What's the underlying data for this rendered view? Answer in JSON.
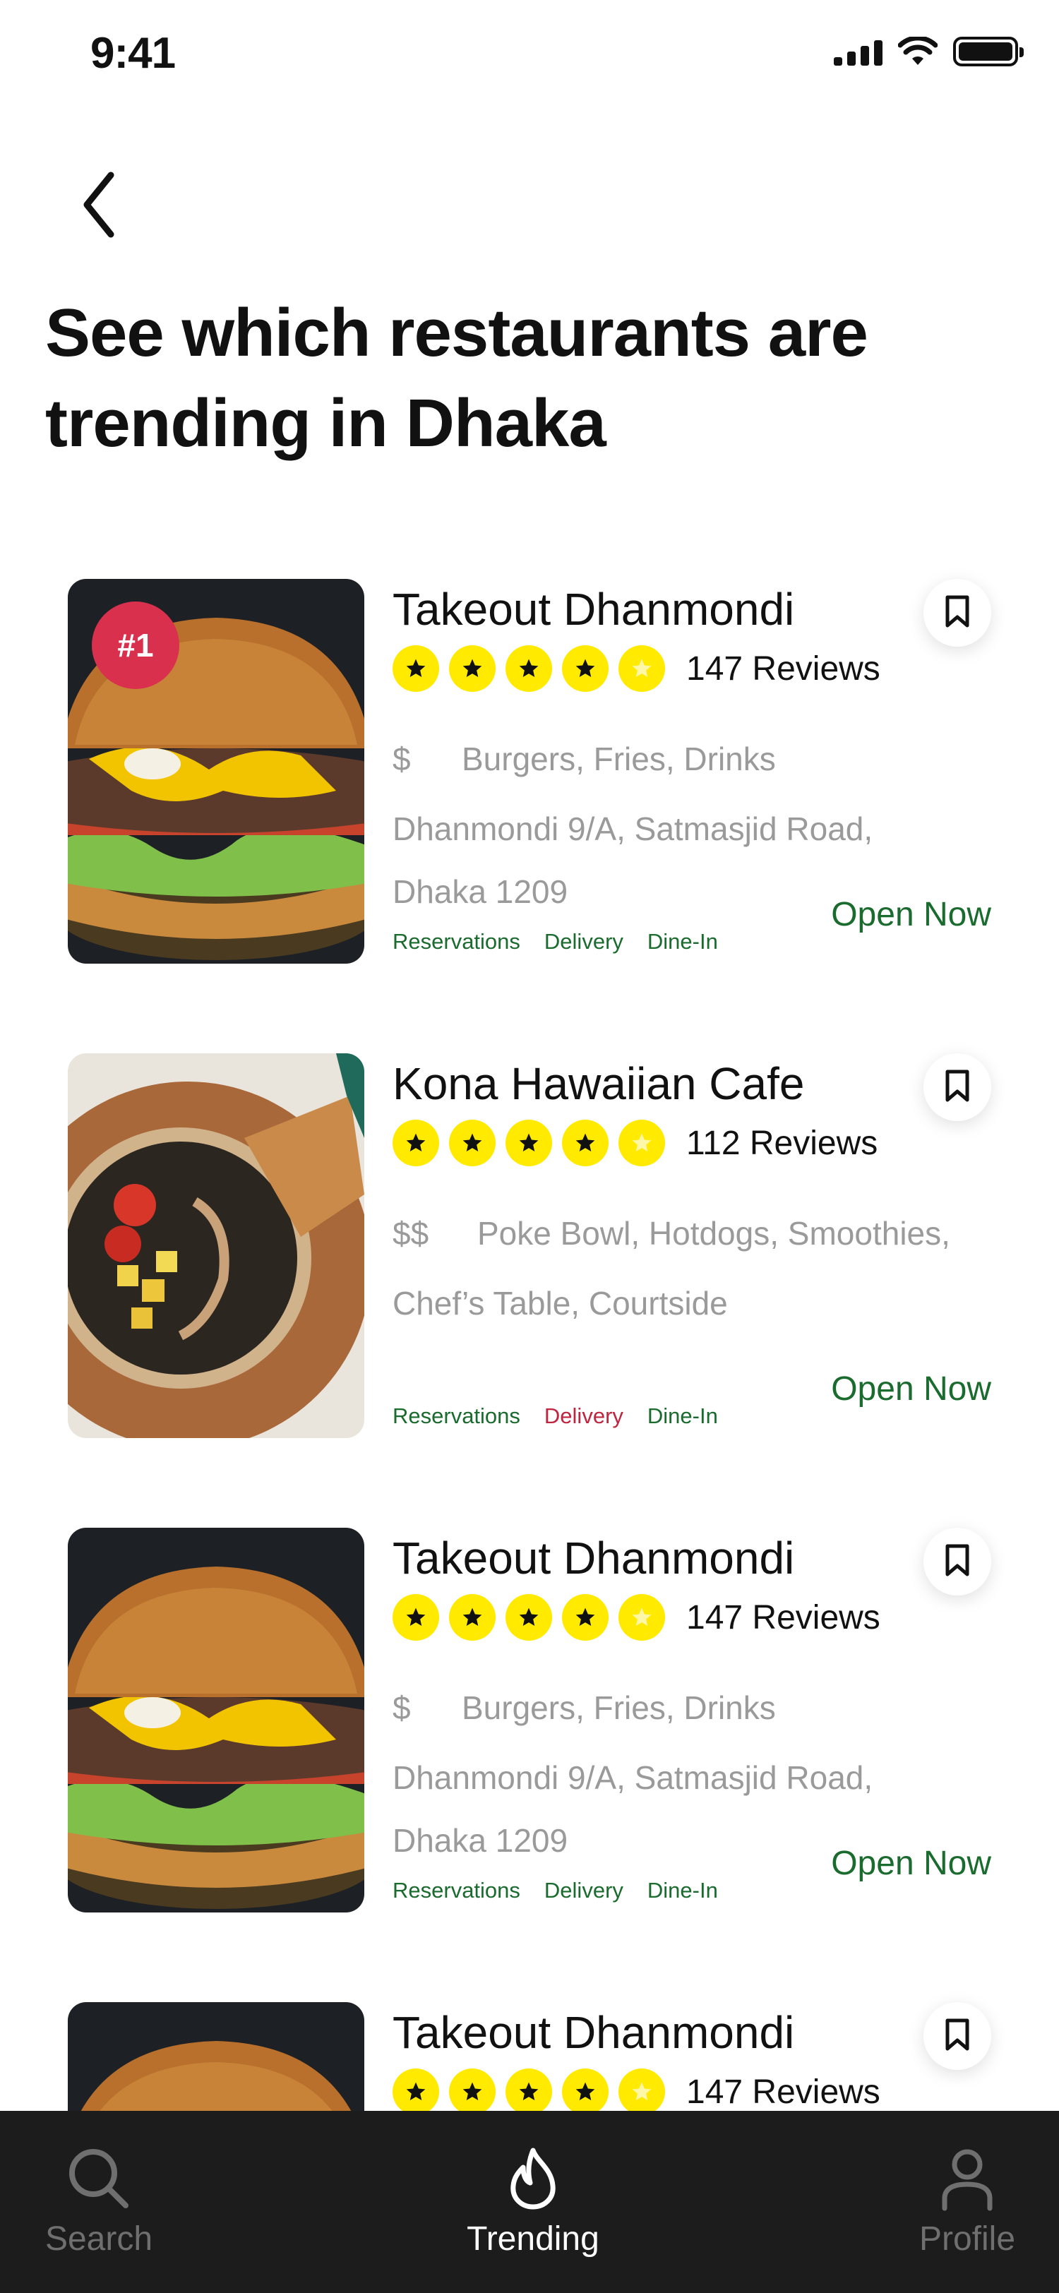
{
  "status_bar": {
    "time": "9:41"
  },
  "header": {
    "title": "See which restaurants are trending in Dhaka"
  },
  "colors": {
    "star": "#FFEA00",
    "badge": "#D9304E",
    "open": "#1A6B2E",
    "service_available": "#1A6B2E",
    "service_unavailable": "#C0253F",
    "nav_background": "#1C1C1C"
  },
  "restaurants": [
    {
      "rank": "#1",
      "name": "Takeout Dhanmondi",
      "rating": 5,
      "reviews": "147 Reviews",
      "price": "$",
      "cuisine": "Burgers, Fries, Drinks",
      "address_line1": "Dhanmondi 9/A, Satmasjid Road,",
      "address_line2": "Dhaka 1209",
      "services": [
        {
          "label": "Reservations",
          "available": true
        },
        {
          "label": "Delivery",
          "available": true
        },
        {
          "label": "Dine-In",
          "available": true
        }
      ],
      "status": "Open Now",
      "image": "burger"
    },
    {
      "rank": "",
      "name": "Kona Hawaiian Cafe",
      "rating": 5,
      "reviews": "112 Reviews",
      "price": "$$",
      "cuisine": "Poke Bowl, Hotdogs, Smoothies,",
      "address_line1": "Chef’s Table, Courtside",
      "address_line2": "",
      "services": [
        {
          "label": "Reservations",
          "available": true
        },
        {
          "label": "Delivery",
          "available": false
        },
        {
          "label": "Dine-In",
          "available": true
        }
      ],
      "status": "Open Now",
      "image": "poke-bowl"
    },
    {
      "rank": "",
      "name": "Takeout Dhanmondi",
      "rating": 5,
      "reviews": "147 Reviews",
      "price": "$",
      "cuisine": "Burgers, Fries, Drinks",
      "address_line1": "Dhanmondi 9/A, Satmasjid Road,",
      "address_line2": "Dhaka 1209",
      "services": [
        {
          "label": "Reservations",
          "available": true
        },
        {
          "label": "Delivery",
          "available": true
        },
        {
          "label": "Dine-In",
          "available": true
        }
      ],
      "status": "Open Now",
      "image": "burger"
    },
    {
      "rank": "",
      "name": "Takeout Dhanmondi",
      "rating": 5,
      "reviews": "147 Reviews",
      "price": "",
      "cuisine": "",
      "address_line1": "",
      "address_line2": "",
      "services": [],
      "status": "",
      "image": "burger"
    }
  ],
  "bottom_nav": {
    "items": [
      {
        "label": "Search",
        "icon": "search-icon",
        "active": false
      },
      {
        "label": "Trending",
        "icon": "flame-icon",
        "active": true
      },
      {
        "label": "Profile",
        "icon": "profile-icon",
        "active": false
      }
    ]
  }
}
